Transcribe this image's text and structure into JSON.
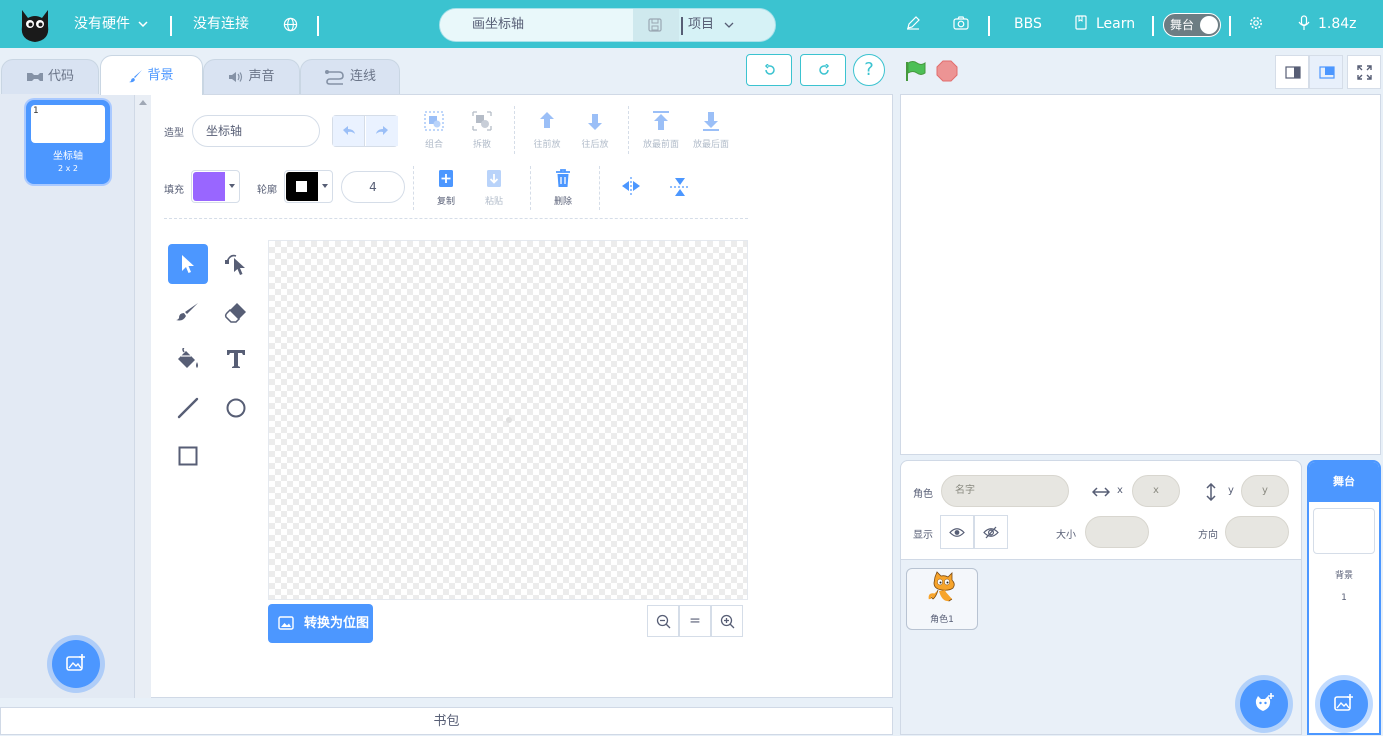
{
  "topbar": {
    "hardware": "没有硬件",
    "connection": "没有连接",
    "project_name": "画坐标轴",
    "project_menu": "项目",
    "bbs": "BBS",
    "learn": "Learn",
    "stage_toggle": "舞台",
    "version": "1.84z"
  },
  "tabs": [
    {
      "label": "代码",
      "icon": "code-icon"
    },
    {
      "label": "背景",
      "icon": "brush-icon",
      "active": true
    },
    {
      "label": "声音",
      "icon": "speaker-icon"
    },
    {
      "label": "连线",
      "icon": "connection-icon"
    }
  ],
  "controls": {
    "help": "?"
  },
  "costumes": [
    {
      "index": "1",
      "name": "坐标轴",
      "size": "2 x 2"
    }
  ],
  "editor": {
    "costume_label": "造型",
    "costume_name": "坐标轴",
    "fill_label": "填充",
    "outline_label": "轮廓",
    "outline_width": "4",
    "fill_color": "#9966ff",
    "outline_color": "#000000",
    "tools_row1": [
      {
        "label": "组合",
        "icon": "group-icon"
      },
      {
        "label": "拆散",
        "icon": "ungroup-icon"
      },
      {
        "label": "往前放",
        "icon": "forward-icon"
      },
      {
        "label": "往后放",
        "icon": "backward-icon"
      },
      {
        "label": "放最前面",
        "icon": "front-icon"
      },
      {
        "label": "放最后面",
        "icon": "back-icon"
      }
    ],
    "tools_row2": [
      {
        "label": "复制",
        "icon": "copy-icon"
      },
      {
        "label": "粘贴",
        "icon": "paste-icon"
      },
      {
        "label": "删除",
        "icon": "delete-icon"
      }
    ],
    "convert_button": "转换为位图",
    "zoom_reset": "="
  },
  "backpack": "书包",
  "sprite_info": {
    "sprite_label": "角色",
    "name_placeholder": "名字",
    "x_label": "x",
    "x_placeholder": "x",
    "y_label": "y",
    "y_placeholder": "y",
    "show_label": "显示",
    "size_label": "大小",
    "direction_label": "方向"
  },
  "sprites": [
    {
      "name": "角色1"
    }
  ],
  "stage_panel": {
    "title": "舞台",
    "backdrop_label": "背景",
    "backdrop_count": "1"
  },
  "colors": {
    "topbar": "#3bc3d0",
    "accent": "#4c97ff",
    "green_flag": "#4cbf56",
    "stop": "#ec9494"
  }
}
